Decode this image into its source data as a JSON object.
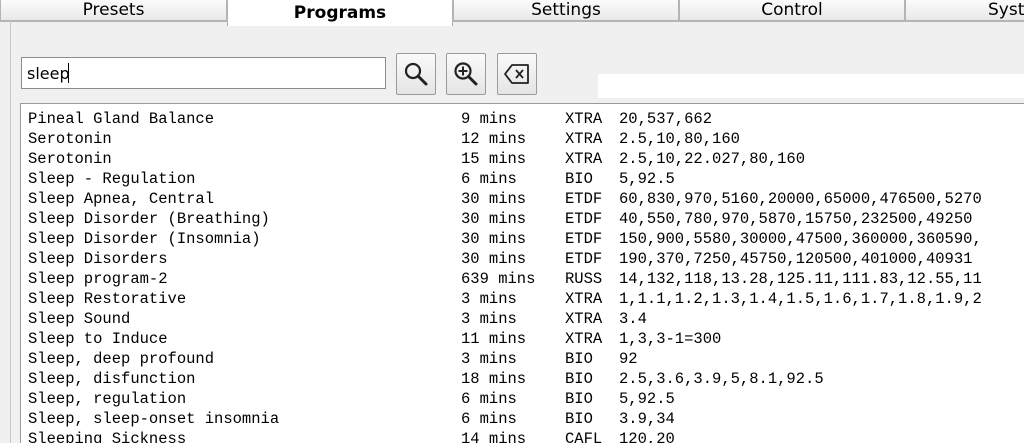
{
  "tabs": [
    {
      "label": "Presets"
    },
    {
      "label": "Programs"
    },
    {
      "label": "Settings"
    },
    {
      "label": "Control"
    },
    {
      "label": "Syste"
    }
  ],
  "search": {
    "value": "sleep",
    "search_icon": "magnifier-icon",
    "zoom_icon": "zoom-in-icon",
    "clear_icon": "clear-backspace-icon"
  },
  "results": [
    {
      "name": "Pineal Gland Balance",
      "duration": "9 mins",
      "type": "XTRA",
      "freqs": "20,537,662"
    },
    {
      "name": "Serotonin",
      "duration": "12 mins",
      "type": "XTRA",
      "freqs": "2.5,10,80,160"
    },
    {
      "name": "Serotonin",
      "duration": "15 mins",
      "type": "XTRA",
      "freqs": "2.5,10,22.027,80,160"
    },
    {
      "name": "Sleep - Regulation",
      "duration": "6 mins",
      "type": "BIO",
      "freqs": "5,92.5"
    },
    {
      "name": "Sleep Apnea, Central",
      "duration": "30 mins",
      "type": "ETDF",
      "freqs": "60,830,970,5160,20000,65000,476500,5270"
    },
    {
      "name": "Sleep Disorder (Breathing)",
      "duration": "30 mins",
      "type": "ETDF",
      "freqs": "40,550,780,970,5870,15750,232500,49250"
    },
    {
      "name": "Sleep Disorder (Insomnia)",
      "duration": "30 mins",
      "type": "ETDF",
      "freqs": "150,900,5580,30000,47500,360000,360590,"
    },
    {
      "name": "Sleep Disorders",
      "duration": "30 mins",
      "type": "ETDF",
      "freqs": "190,370,7250,45750,120500,401000,40931"
    },
    {
      "name": "Sleep program-2",
      "duration": "639 mins",
      "type": "RUSS",
      "freqs": "14,132,118,13.28,125.11,111.83,12.55,11"
    },
    {
      "name": "Sleep Restorative",
      "duration": "3 mins",
      "type": "XTRA",
      "freqs": "1,1.1,1.2,1.3,1.4,1.5,1.6,1.7,1.8,1.9,2"
    },
    {
      "name": "Sleep Sound",
      "duration": "3 mins",
      "type": "XTRA",
      "freqs": "3.4"
    },
    {
      "name": "Sleep to Induce",
      "duration": "11 mins",
      "type": "XTRA",
      "freqs": "1,3,3-1=300"
    },
    {
      "name": "Sleep, deep profound",
      "duration": "3 mins",
      "type": "BIO",
      "freqs": "92"
    },
    {
      "name": "Sleep, disfunction",
      "duration": "18 mins",
      "type": "BIO",
      "freqs": "2.5,3.6,3.9,5,8.1,92.5"
    },
    {
      "name": "Sleep, regulation",
      "duration": "6 mins",
      "type": "BIO",
      "freqs": "5,92.5"
    },
    {
      "name": "Sleep, sleep-onset insomnia",
      "duration": "6 mins",
      "type": "BIO",
      "freqs": "3.9,34"
    },
    {
      "name": "Sleeping Sickness",
      "duration": "14 mins",
      "type": "CAFL",
      "freqs": "120,20"
    }
  ]
}
